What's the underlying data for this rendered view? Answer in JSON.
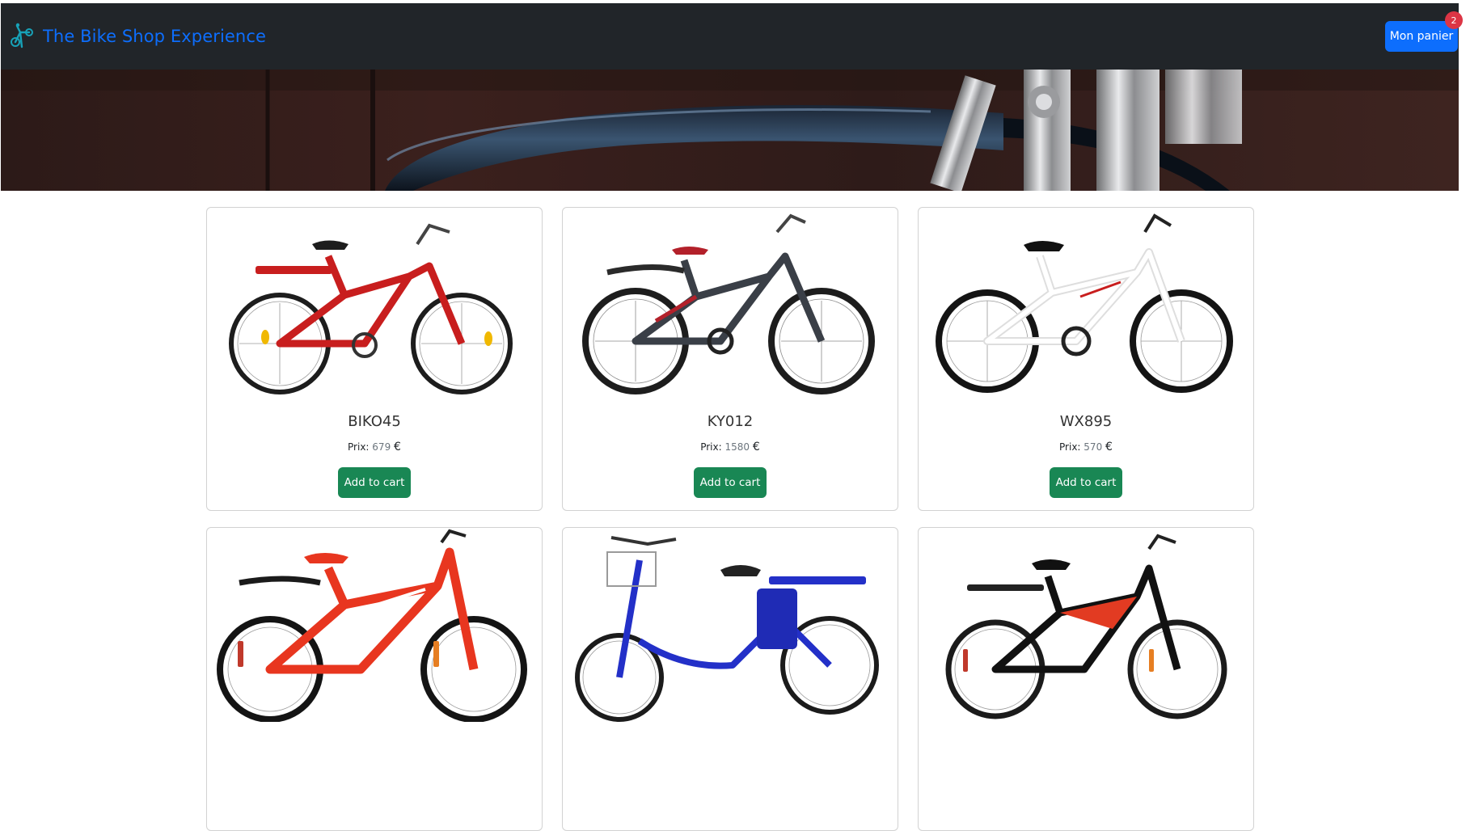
{
  "navbar": {
    "brand_text": "The Bike Shop Experience",
    "logo_icon": "bicycle-rider-icon",
    "cart_label": "Mon panier",
    "cart_count": "2",
    "bg_color": "#212529",
    "brand_color": "#0d6efd"
  },
  "hero": {
    "image": "bicycle-fender-closeup-banner"
  },
  "products": [
    {
      "name": "BIKO45",
      "price_label": "Prix:",
      "price": "679",
      "currency": "€",
      "button": "Add to cart",
      "image": "red-mountain-bike-with-rack",
      "frame_color": "#c81e1e"
    },
    {
      "name": "KY012",
      "price_label": "Prix:",
      "price": "1580",
      "currency": "€",
      "button": "Add to cart",
      "image": "grey-black-mountain-bike",
      "frame_color": "#3a3f47"
    },
    {
      "name": "WX895",
      "price_label": "Prix:",
      "price": "570",
      "currency": "€",
      "button": "Add to cart",
      "image": "white-mountain-bike",
      "frame_color": "#f2f2f2"
    },
    {
      "name": "",
      "price_label": "",
      "price": "",
      "currency": "",
      "button": "",
      "image": "red-white-next-bike",
      "frame_color": "#e8361f"
    },
    {
      "name": "",
      "price_label": "",
      "price": "",
      "currency": "",
      "button": "",
      "image": "blue-electric-bike-with-basket",
      "frame_color": "#2330c8"
    },
    {
      "name": "",
      "price_label": "",
      "price": "",
      "currency": "",
      "button": "",
      "image": "red-black-bike-with-rack",
      "frame_color": "#e23b22"
    }
  ]
}
